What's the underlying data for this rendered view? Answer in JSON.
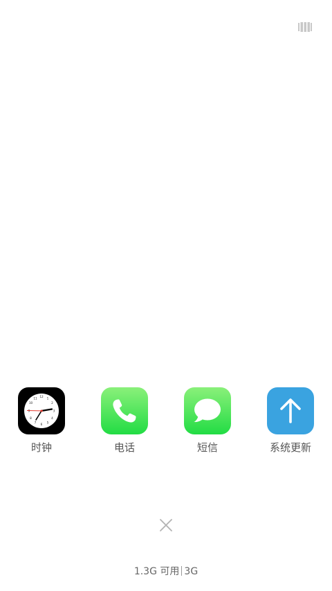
{
  "recent_apps": [
    {
      "label": "时钟",
      "icon": "clock-icon"
    },
    {
      "label": "电话",
      "icon": "phone-icon"
    },
    {
      "label": "短信",
      "icon": "messages-icon"
    },
    {
      "label": "系统更新",
      "icon": "system-update-icon"
    }
  ],
  "memory": {
    "available": "1.3G 可用",
    "total": "3G"
  },
  "controls": {
    "layout_toggle_icon": "grid-layout-icon",
    "close_all_icon": "close-icon"
  },
  "colors": {
    "phone_gradient": [
      "#8af07a",
      "#22dc44"
    ],
    "messages_gradient": [
      "#8af07a",
      "#22dc44"
    ],
    "update_blue": "#3aa3e0",
    "clock_bg": "#000000"
  }
}
